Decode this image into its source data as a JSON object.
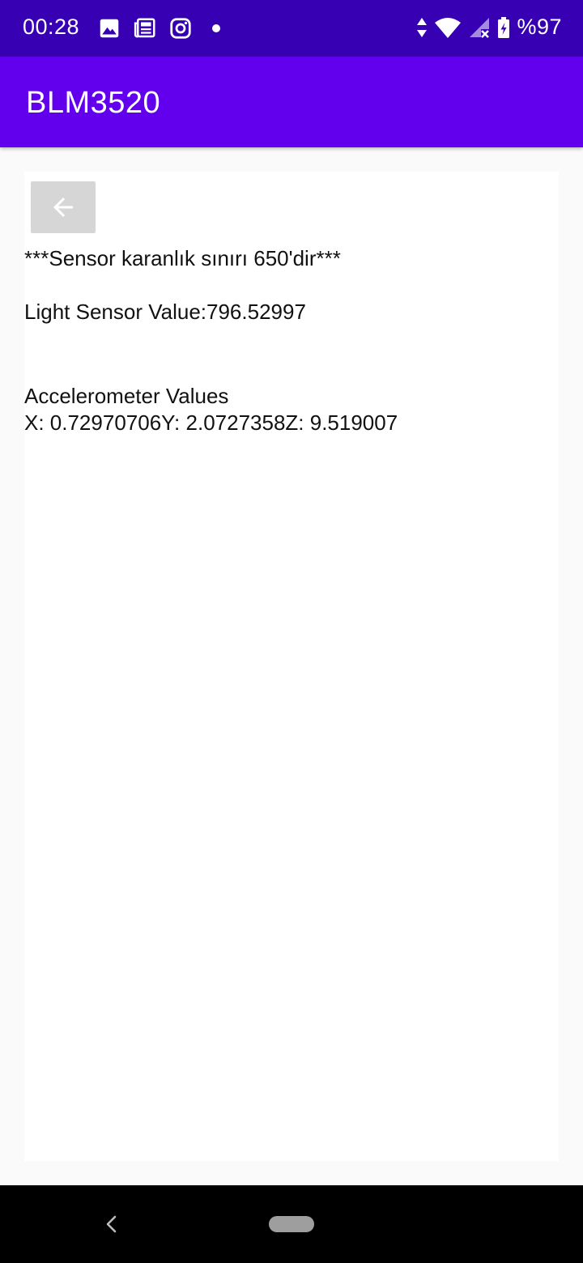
{
  "status_bar": {
    "time": "00:28",
    "battery": "%97",
    "icons_left": [
      "image-icon",
      "news-icon",
      "instagram-icon",
      "notification-dot-icon"
    ],
    "icons_right": [
      "data-arrows-icon",
      "wifi-icon",
      "cellular-no-signal-icon",
      "battery-charging-icon"
    ]
  },
  "app_bar": {
    "title": "BLM3520"
  },
  "content": {
    "back_button_icon": "arrow-back-icon",
    "threshold_text": "***Sensor karanlık sınırı 650'dir***",
    "light_sensor_text": "Light Sensor Value:796.52997",
    "accelerometer_title": "Accelerometer Values",
    "accelerometer_values": "X: 0.72970706Y: 2.0727358Z: 9.519007"
  },
  "navigation_bar": {
    "icons": [
      "nav-back-icon",
      "nav-home-pill"
    ]
  },
  "colors": {
    "status_bar": "#3700b3",
    "app_bar": "#6200ee",
    "background": "#fafafa",
    "card": "#ffffff",
    "back_button": "#d6d6d6",
    "nav_bar": "#000000"
  }
}
